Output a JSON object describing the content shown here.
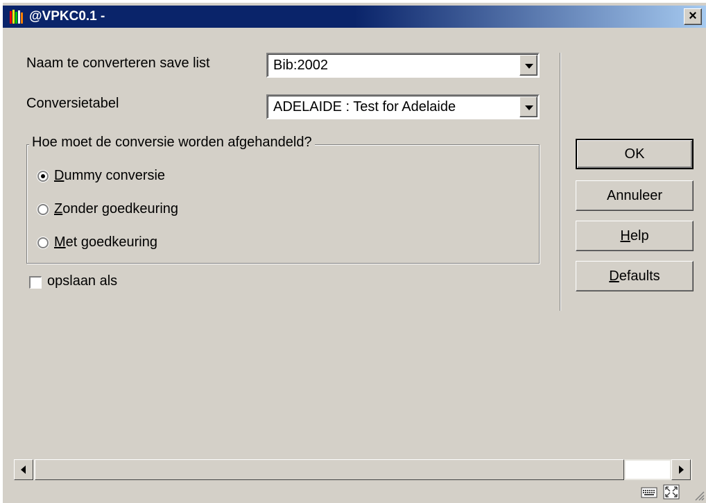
{
  "window": {
    "title": "@VPKC0.1 -",
    "close_label": "×"
  },
  "form": {
    "savelist_label": "Naam te converteren save list",
    "savelist_value": "Bib:2002",
    "table_label": "Conversietabel",
    "table_value": "ADELAIDE : Test for Adelaide"
  },
  "group": {
    "legend": "Hoe moet de conversie worden afgehandeld?",
    "options": [
      {
        "first": "D",
        "rest": "ummy conversie",
        "selected": true
      },
      {
        "first": "Z",
        "rest": "onder goedkeuring",
        "selected": false
      },
      {
        "first": "M",
        "rest": "et goedkeuring",
        "selected": false
      }
    ]
  },
  "checkbox": {
    "label": "opslaan als",
    "checked": false
  },
  "buttons": {
    "ok": "OK",
    "cancel": "Annuleer",
    "help_first": "H",
    "help_rest": "elp",
    "defaults_first": "D",
    "defaults_rest": "efaults"
  },
  "icons": {
    "app": "library-books-icon",
    "close": "close-icon",
    "dropdown": "chevron-down-icon",
    "scroll_left": "arrow-left-icon",
    "scroll_right": "arrow-right-icon",
    "keyboard": "keyboard-icon",
    "resize": "resize-icon"
  },
  "colors": {
    "titlebar": "#0a246a",
    "face": "#d4d0c8"
  }
}
